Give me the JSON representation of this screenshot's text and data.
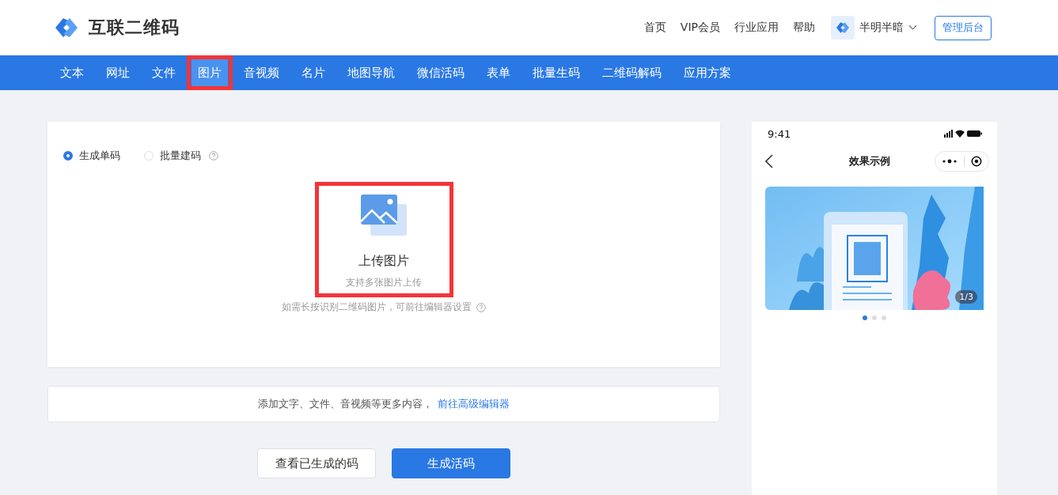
{
  "header": {
    "logo_text": "互联二维码",
    "links": [
      "首页",
      "VIP会员",
      "行业应用",
      "帮助"
    ],
    "user": {
      "name": "半明半暗"
    },
    "admin_button": "管理后台"
  },
  "tabs": [
    {
      "label": "文本",
      "selected": false,
      "highlighted": false
    },
    {
      "label": "网址",
      "selected": false,
      "highlighted": false
    },
    {
      "label": "文件",
      "selected": false,
      "highlighted": false
    },
    {
      "label": "图片",
      "selected": true,
      "highlighted": true
    },
    {
      "label": "音视频",
      "selected": false,
      "highlighted": false
    },
    {
      "label": "名片",
      "selected": false,
      "highlighted": false
    },
    {
      "label": "地图导航",
      "selected": false,
      "highlighted": false
    },
    {
      "label": "微信活码",
      "selected": false,
      "highlighted": false
    },
    {
      "label": "表单",
      "selected": false,
      "highlighted": false
    },
    {
      "label": "批量生码",
      "selected": false,
      "highlighted": false
    },
    {
      "label": "二维码解码",
      "selected": false,
      "highlighted": false
    },
    {
      "label": "应用方案",
      "selected": false,
      "highlighted": false
    }
  ],
  "modes": [
    {
      "label": "生成单码",
      "selected": true,
      "help": false
    },
    {
      "label": "批量建码",
      "selected": false,
      "help": true
    }
  ],
  "upload": {
    "title": "上传图片",
    "subtitle": "支持多张图片上传",
    "highlighted": true
  },
  "hint": "如需长按识别二维码图片，可前往编辑器设置",
  "editor_bar": {
    "text": "添加文字、文件、音视频等更多内容，",
    "link": "前往高级编辑器"
  },
  "buttons": [
    {
      "label": "查看已生成的码",
      "kind": "secondary"
    },
    {
      "label": "生成活码",
      "kind": "primary"
    }
  ],
  "preview": {
    "time": "9:41",
    "title": "效果示例",
    "counter": "1/3",
    "dots": [
      {
        "selected": true
      },
      {
        "selected": false
      },
      {
        "selected": false
      }
    ]
  }
}
